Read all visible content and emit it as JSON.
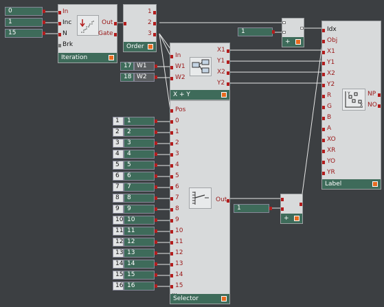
{
  "constants_top": [
    "0",
    "1",
    "15"
  ],
  "iteration": {
    "title": "Iteration",
    "inputs": [
      "In",
      "Inc",
      "N",
      "Brk"
    ],
    "outputs": [
      "Out",
      "Gate"
    ]
  },
  "order": {
    "title": "Order",
    "outputs": [
      "1",
      "2",
      "3"
    ]
  },
  "add_top": {
    "title": "+",
    "constant": "1"
  },
  "label_module": {
    "title": "Label",
    "inputs": [
      "Idx",
      "Obj",
      "X1",
      "Y1",
      "X2",
      "Y2",
      "R",
      "G",
      "B",
      "A",
      "XO",
      "XR",
      "YO",
      "YR"
    ],
    "outputs": [
      "NP",
      "NO"
    ]
  },
  "xy_module": {
    "title": "X + Y",
    "inputs": [
      "In",
      "W1",
      "W2"
    ],
    "outputs": [
      "X1",
      "Y1",
      "X2",
      "Y2"
    ]
  },
  "w_inputs": [
    {
      "value": "17",
      "label": "W1"
    },
    {
      "value": "18",
      "label": "W2"
    }
  ],
  "selector": {
    "title": "Selector",
    "pos_label": "Pos",
    "inputs": [
      "0",
      "1",
      "2",
      "3",
      "4",
      "5",
      "6",
      "7",
      "8",
      "9",
      "10",
      "11",
      "12",
      "13",
      "14",
      "15"
    ],
    "output": "Out"
  },
  "selector_consts": [
    {
      "index": "1",
      "value": "1"
    },
    {
      "index": "2",
      "value": "2"
    },
    {
      "index": "3",
      "value": "3"
    },
    {
      "index": "4",
      "value": "4"
    },
    {
      "index": "5",
      "value": "5"
    },
    {
      "index": "6",
      "value": "6"
    },
    {
      "index": "7",
      "value": "7"
    },
    {
      "index": "8",
      "value": "8"
    },
    {
      "index": "9",
      "value": "9"
    },
    {
      "index": "10",
      "value": "10"
    },
    {
      "index": "11",
      "value": "11"
    },
    {
      "index": "12",
      "value": "12"
    },
    {
      "index": "13",
      "value": "13"
    },
    {
      "index": "14",
      "value": "14"
    },
    {
      "index": "15",
      "value": "15"
    },
    {
      "index": "16",
      "value": "16"
    }
  ],
  "add_bottom": {
    "title": "+",
    "constant": "1"
  },
  "colors": {
    "background": "#3c3f42",
    "panel": "#d8dadb",
    "footer": "#3e6b5a",
    "port": "#b31d1d",
    "indicator": "#e66a1f",
    "wire": "#e8e8e8"
  }
}
